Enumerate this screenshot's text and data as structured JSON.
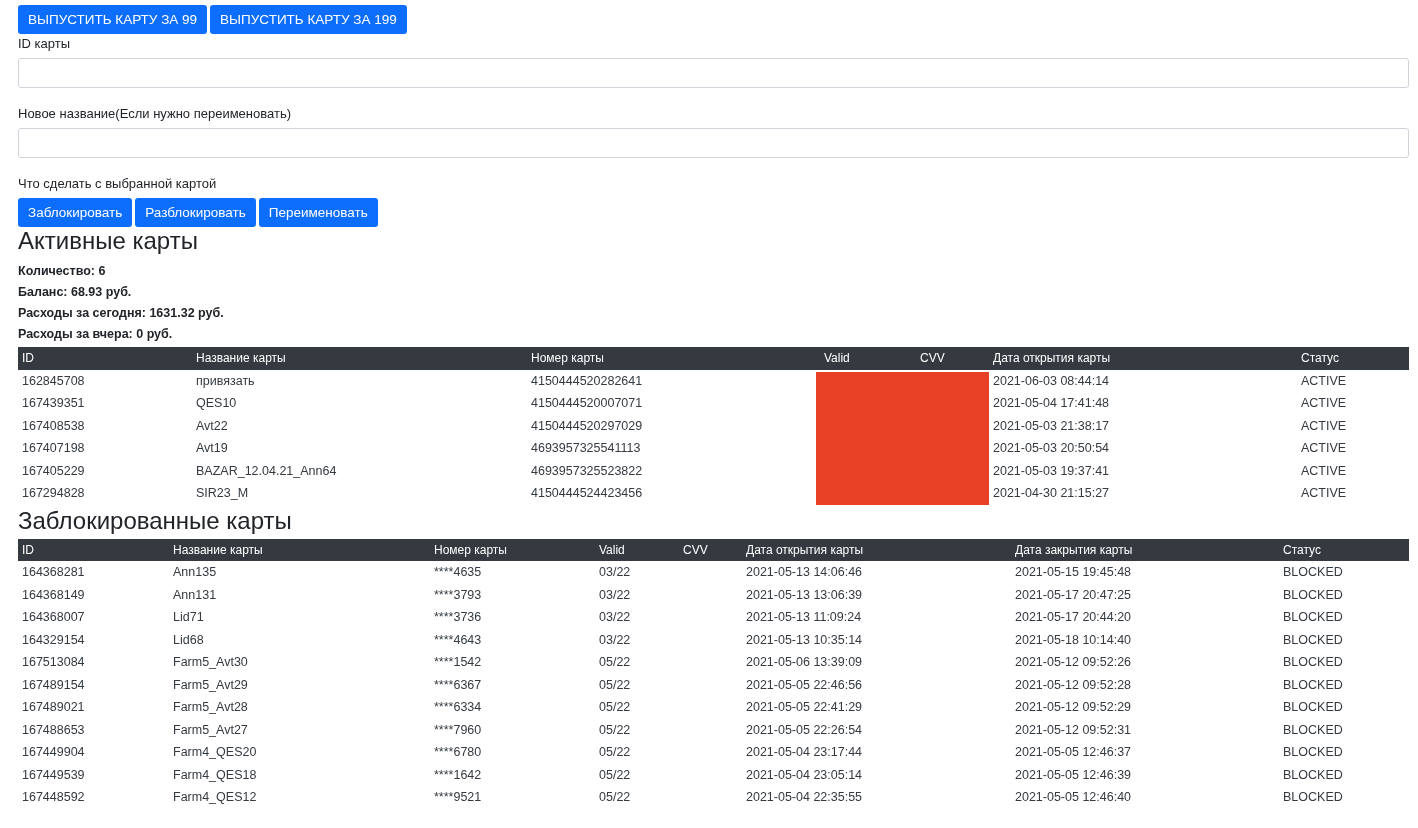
{
  "issue_buttons": [
    "ВЫПУСТИТЬ КАРТУ ЗА 99",
    "ВЫПУСТИТЬ КАРТУ ЗА 199"
  ],
  "card_id_field": {
    "label": "ID карты"
  },
  "rename_field": {
    "label": "Новое название(Если нужно переименовать)"
  },
  "actions": {
    "label": "Что сделать с выбранной картой",
    "buttons": [
      "Заблокировать",
      "Разблокировать",
      "Переименовать"
    ]
  },
  "active_cards": {
    "title": "Активные карты",
    "stats": [
      "Количество: 6",
      "Баланс: 68.93 руб.",
      "Расходы за сегодня: 1631.32 руб.",
      "Расходы за вчера: 0 руб."
    ],
    "table": {
      "columns": [
        "ID",
        "Название карты",
        "Номер карты",
        "Valid",
        "CVV",
        "Дата открытия карты",
        "Статус"
      ],
      "rows": [
        [
          "162845708",
          "привязать",
          "4150444520282641",
          "2021-06-03 08:44:14",
          "ACTIVE"
        ],
        [
          "167439351",
          "QES10",
          "4150444520007071",
          "2021-05-04 17:41:48",
          "ACTIVE"
        ],
        [
          "167408538",
          "Avt22",
          "4150444520297029",
          "2021-05-03 21:38:17",
          "ACTIVE"
        ],
        [
          "167407198",
          "Avt19",
          "4693957325541113",
          "2021-05-03 20:50:54",
          "ACTIVE"
        ],
        [
          "167405229",
          "BAZAR_12.04.21_Ann64",
          "4693957325523822",
          "2021-05-03 19:37:41",
          "ACTIVE"
        ],
        [
          "167294828",
          "SIR23_M",
          "4150444524423456",
          "2021-04-30 21:15:27",
          "ACTIVE"
        ]
      ]
    }
  },
  "blocked_cards": {
    "title": "Заблокированные карты",
    "table": {
      "columns": [
        "ID",
        "Название карты",
        "Номер карты",
        "Valid",
        "CVV",
        "Дата открытия карты",
        "Дата закрытия карты",
        "Статус"
      ],
      "rows": [
        [
          "164368281",
          "Ann135",
          "****4635",
          "03/22",
          "",
          "2021-05-13 14:06:46",
          "2021-05-15 19:45:48",
          "BLOCKED"
        ],
        [
          "164368149",
          "Ann131",
          "****3793",
          "03/22",
          "",
          "2021-05-13 13:06:39",
          "2021-05-17 20:47:25",
          "BLOCKED"
        ],
        [
          "164368007",
          "Lid71",
          "****3736",
          "03/22",
          "",
          "2021-05-13 11:09:24",
          "2021-05-17 20:44:20",
          "BLOCKED"
        ],
        [
          "164329154",
          "Lid68",
          "****4643",
          "03/22",
          "",
          "2021-05-13 10:35:14",
          "2021-05-18 10:14:40",
          "BLOCKED"
        ],
        [
          "167513084",
          "Farm5_Avt30",
          "****1542",
          "05/22",
          "",
          "2021-05-06 13:39:09",
          "2021-05-12 09:52:26",
          "BLOCKED"
        ],
        [
          "167489154",
          "Farm5_Avt29",
          "****6367",
          "05/22",
          "",
          "2021-05-05 22:46:56",
          "2021-05-12 09:52:28",
          "BLOCKED"
        ],
        [
          "167489021",
          "Farm5_Avt28",
          "****6334",
          "05/22",
          "",
          "2021-05-05 22:41:29",
          "2021-05-12 09:52:29",
          "BLOCKED"
        ],
        [
          "167488653",
          "Farm5_Avt27",
          "****7960",
          "05/22",
          "",
          "2021-05-05 22:26:54",
          "2021-05-12 09:52:31",
          "BLOCKED"
        ],
        [
          "167449904",
          "Farm4_QES20",
          "****6780",
          "05/22",
          "",
          "2021-05-04 23:17:44",
          "2021-05-05 12:46:37",
          "BLOCKED"
        ],
        [
          "167449539",
          "Farm4_QES18",
          "****1642",
          "05/22",
          "",
          "2021-05-04 23:05:14",
          "2021-05-05 12:46:39",
          "BLOCKED"
        ],
        [
          "167448592",
          "Farm4_QES12",
          "****9521",
          "05/22",
          "",
          "2021-05-04 22:35:55",
          "2021-05-05 12:46:40",
          "BLOCKED"
        ]
      ]
    }
  }
}
